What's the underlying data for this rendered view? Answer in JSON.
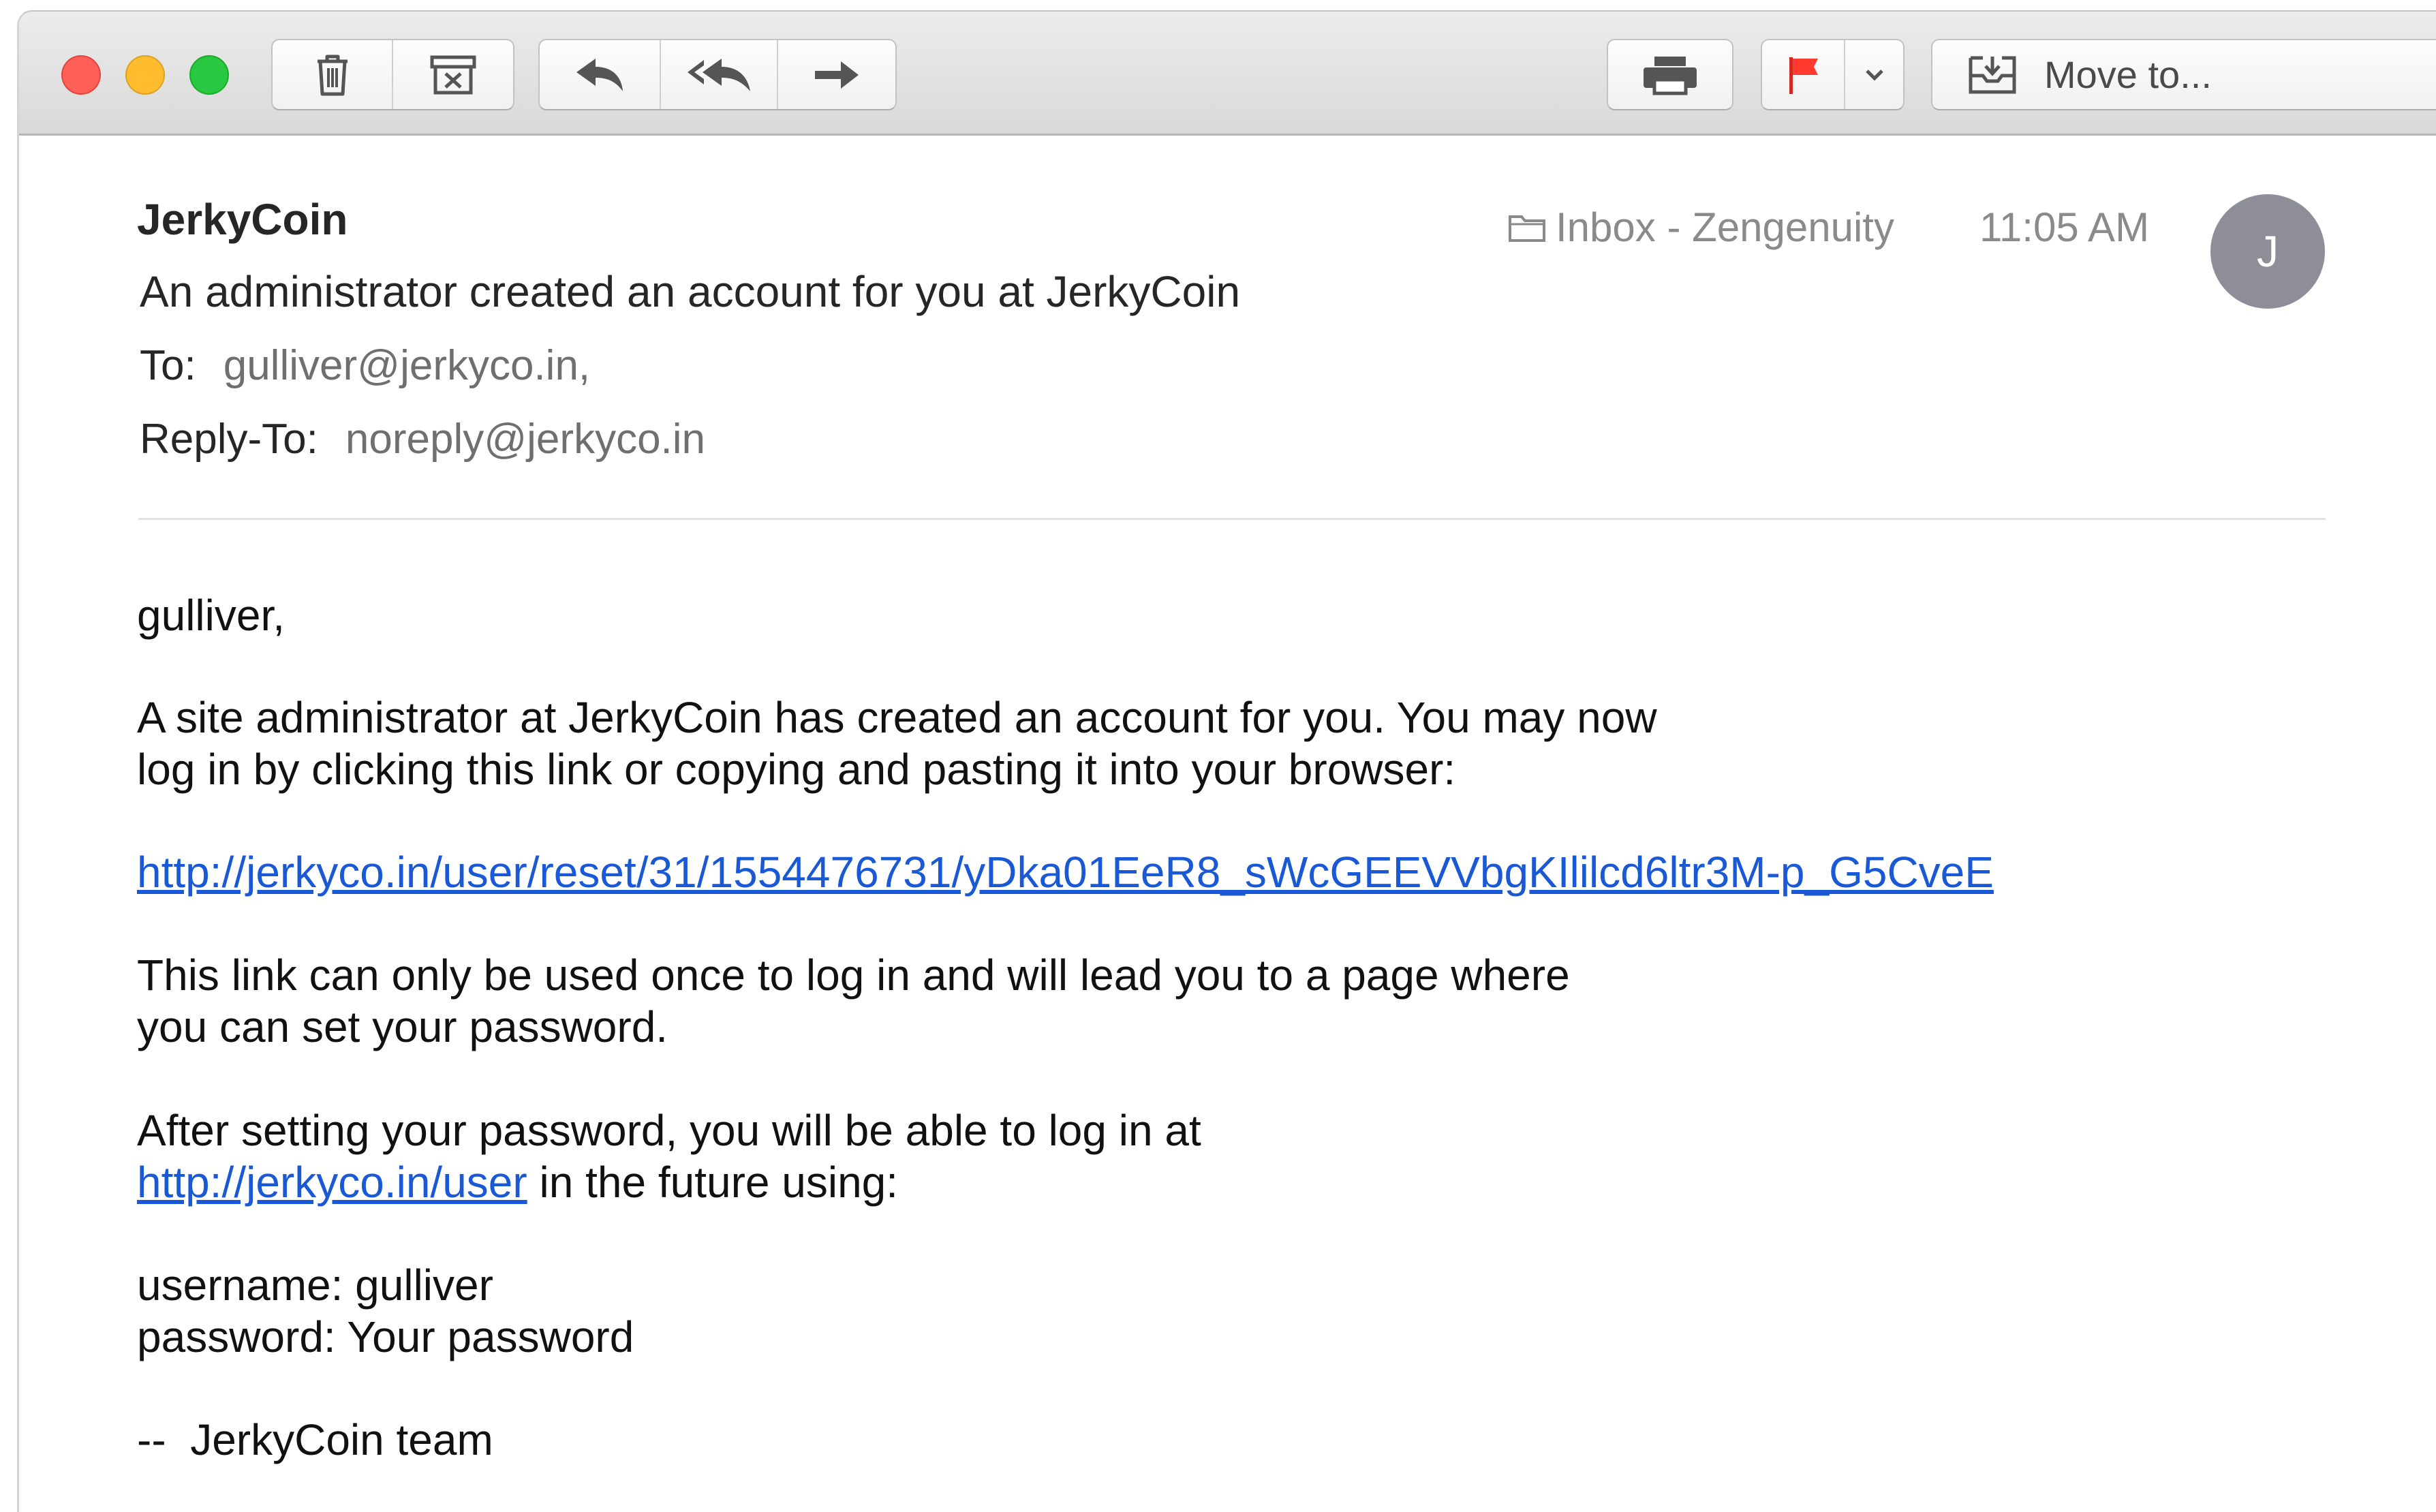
{
  "toolbar": {
    "buttons": {
      "delete": "trash-icon",
      "archive": "archive-icon",
      "reply": "reply-icon",
      "reply_all": "reply-all-icon",
      "forward": "forward-icon",
      "print": "printer-icon",
      "flag": "flag-icon",
      "flag_menu": "chevron-down-icon",
      "move": "move-to-icon"
    },
    "move_to_label": "Move to...",
    "flag_color": "#ff3b30"
  },
  "message": {
    "sender": "JerkyCoin",
    "subject": "An administrator created an account for you at JerkyCoin",
    "to_label": "To:",
    "to_value": "gulliver@jerkyco.in,",
    "reply_to_label": "Reply-To:",
    "reply_to_value": "noreply@jerkyco.in",
    "mailbox": "Inbox - Zengenuity",
    "time": "11:05 AM",
    "avatar_initial": "J",
    "avatar_color": "#8e8e99"
  },
  "body": {
    "greeting": "gulliver,",
    "para1_line1": "A site administrator at JerkyCoin has created an account for you. You may now",
    "para1_line2": "log in by clicking this link or copying and pasting it into your browser:",
    "reset_link": "http://jerkyco.in/user/reset/31/1554476731/yDka01EeR8_sWcGEEVVbgKIlilcd6ltr3M-p_G5CveE",
    "para2_line1": "This link can only be used once to log in and will lead you to a page where",
    "para2_line2": "you can set your password.",
    "para3_line1": "After setting your password, you will be able to log in at",
    "user_link": "http://jerkyco.in/user",
    "para3_line2_rest": " in the future using:",
    "username_line": "username: gulliver",
    "password_line": "password: Your password",
    "signature": "--  JerkyCoin team"
  },
  "colors": {
    "link": "#1a59d6",
    "close": "#fe5f57",
    "minimize": "#febc2e",
    "zoom": "#28c840"
  }
}
